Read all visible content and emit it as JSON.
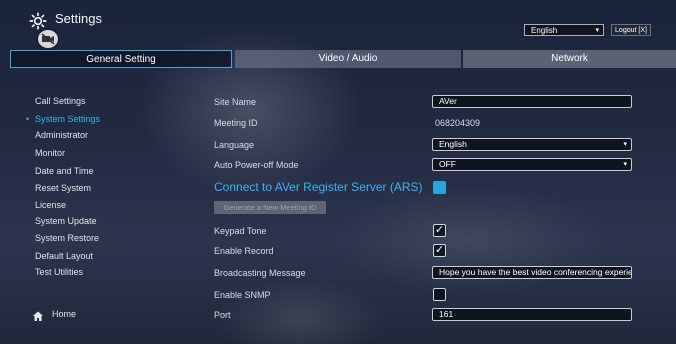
{
  "header": {
    "title": "Settings",
    "language_selected": "English",
    "logout_label": "Logout [X]"
  },
  "tabs": [
    {
      "label": "General Setting"
    },
    {
      "label": "Video / Audio"
    },
    {
      "label": "Network"
    }
  ],
  "sidebar": {
    "items": [
      {
        "label": "Call Settings"
      },
      {
        "label": "System Settings"
      },
      {
        "label": "Administrator"
      },
      {
        "label": "Monitor"
      },
      {
        "label": "Date and Time"
      },
      {
        "label": "Reset System"
      },
      {
        "label": "License"
      },
      {
        "label": "System Update"
      },
      {
        "label": "System Restore"
      },
      {
        "label": "Default Layout"
      },
      {
        "label": "Test Utilities"
      }
    ],
    "active_index": 1,
    "home_label": "Home"
  },
  "form": {
    "site_name": {
      "label": "Site Name",
      "value": "AVer"
    },
    "meeting_id": {
      "label": "Meeting ID",
      "value": "068204309"
    },
    "language": {
      "label": "Language",
      "value": "English"
    },
    "auto_power_off": {
      "label": "Auto Power-off Mode",
      "value": "OFF"
    },
    "ars": {
      "label": "Connect to AVer Register Server (ARS)",
      "checked": true
    },
    "generate_button": "Generate a New Meeting ID",
    "keypad_tone": {
      "label": "Keypad Tone",
      "checked": true
    },
    "enable_record": {
      "label": "Enable Record",
      "checked": true
    },
    "broadcasting_message": {
      "label": "Broadcasting Message",
      "value": "Hope you have the best video conferencing experie"
    },
    "enable_snmp": {
      "label": "Enable SNMP",
      "checked": false
    },
    "port": {
      "label": "Port",
      "value": "161"
    }
  },
  "colors": {
    "accent": "#3cb3f0",
    "active_tab_border": "#4aa3d8",
    "ars_toggle": "#2aa5e0"
  },
  "icons": {
    "app": "gear-icon",
    "badge": "camera-off-icon",
    "home": "home-icon",
    "check": "checkmark-icon"
  }
}
